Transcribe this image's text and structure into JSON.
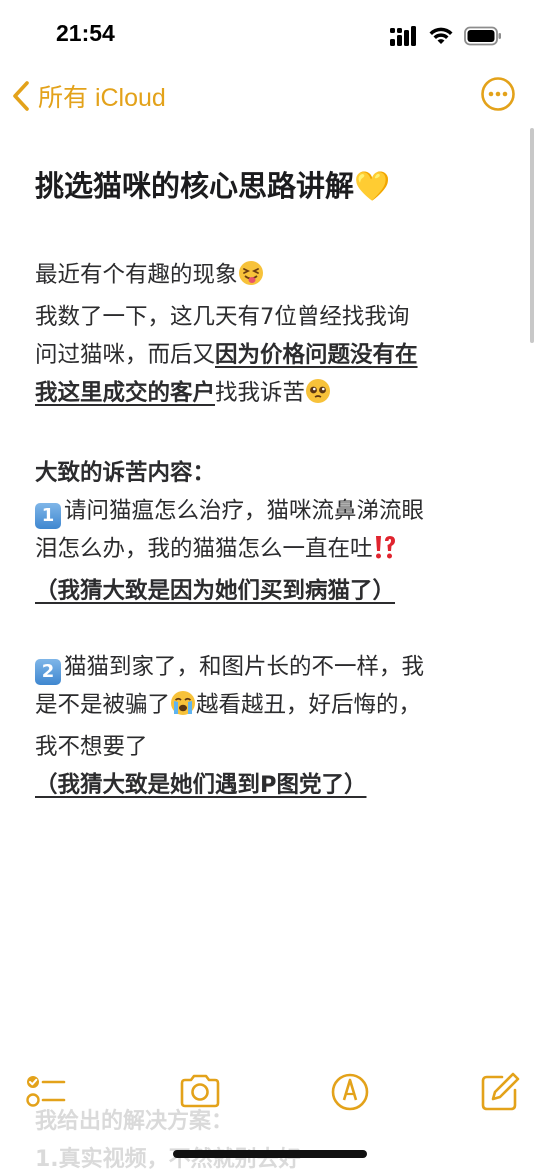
{
  "status_bar": {
    "time": "21:54"
  },
  "nav": {
    "back_label": "所有 iCloud"
  },
  "colors": {
    "accent": "#e3a21a",
    "text": "#1c1c1e"
  },
  "note": {
    "title": "挑选猫咪的核心思路讲解💛",
    "p1": {
      "l1": "最近有个有趣的现象",
      "l2": "我数了一下，这几天有7位曾经找我询",
      "l3a": "问过猫咪，而后又",
      "l3b": "因为价格问题没有在",
      "l4a": "我这里成交的客户",
      "l4b": "找我诉苦"
    },
    "p2": {
      "heading": "大致的诉苦内容：",
      "k1": "1",
      "l1": "请问猫瘟怎么治疗，猫咪流鼻涕流眼",
      "l2": "泪怎么办，我的猫猫怎么一直在吐",
      "guess": "（我猜大致是因为她们买到病猫了）"
    },
    "p3": {
      "k2": "2",
      "l1": "猫猫到家了，和图片长的不一样，我",
      "l2a": "是不是被骗了",
      "l2b": "越看越丑，好后悔的，",
      "l3": "我不想要了",
      "guess": "（我猜大致是她们遇到P图党了）"
    },
    "faded": {
      "l1": "我给出的解决方案：",
      "l2": "1.真实视频，不然就别去好"
    }
  },
  "icons": {
    "signal": "signal-icon",
    "wifi": "wifi-icon",
    "battery": "battery-icon",
    "back": "chevron-left-icon",
    "more": "more-icon",
    "checklist": "checklist-icon",
    "camera": "camera-icon",
    "markup": "markup-icon",
    "compose": "compose-icon"
  }
}
